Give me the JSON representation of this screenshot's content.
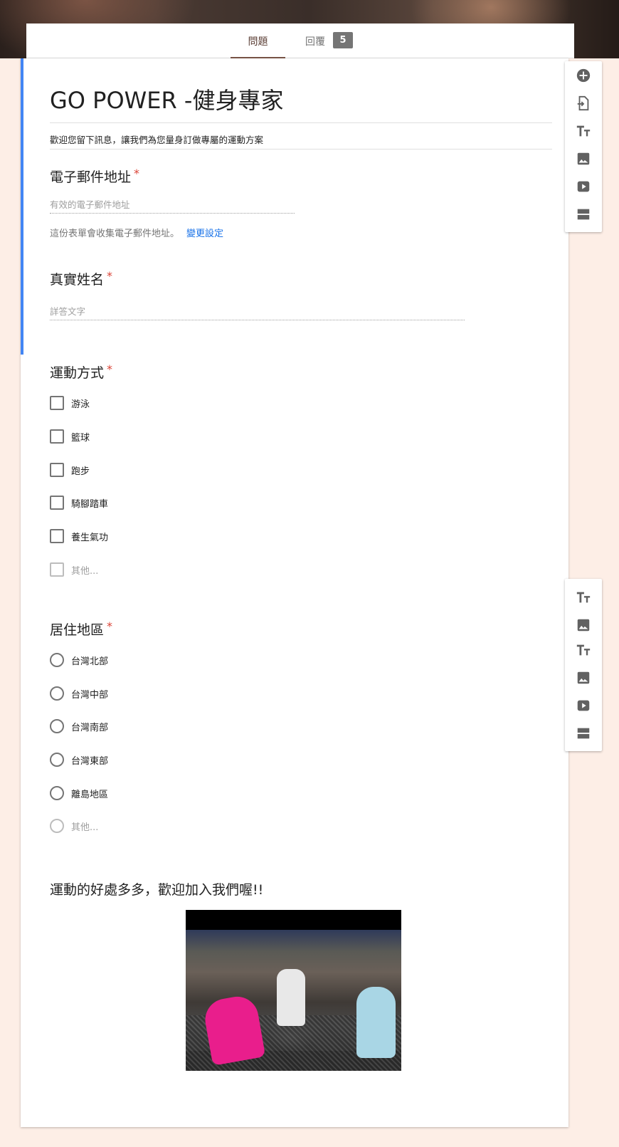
{
  "tabs": {
    "questions_label": "問題",
    "responses_label": "回覆",
    "responses_count": "5"
  },
  "form": {
    "title": "GO POWER -健身專家",
    "description": "歡迎您留下訊息，讓我們為您量身訂做專屬的運動方案"
  },
  "email_question": {
    "title": "電子郵件地址",
    "required_mark": "*",
    "placeholder": "有效的電子郵件地址",
    "note": "這份表單會收集電子郵件地址。",
    "change_link": "變更設定"
  },
  "name_question": {
    "title": "真實姓名",
    "required_mark": "*",
    "placeholder": "詳答文字"
  },
  "exercise_question": {
    "title": "運動方式",
    "required_mark": "*",
    "options": [
      "游泳",
      "籃球",
      "跑步",
      "騎腳踏車",
      "養生氣功"
    ],
    "other_label": "其他..."
  },
  "region_question": {
    "title": "居住地區",
    "required_mark": "*",
    "options": [
      "台灣北部",
      "台灣中部",
      "台灣南部",
      "台灣東部",
      "離島地區"
    ],
    "other_label": "其他..."
  },
  "video_section": {
    "title": "運動的好處多多，歡迎加入我們喔!!"
  },
  "colors": {
    "accent": "#4285f4",
    "required": "#db4437",
    "tab_active": "#795548",
    "background": "#fdeee6"
  }
}
